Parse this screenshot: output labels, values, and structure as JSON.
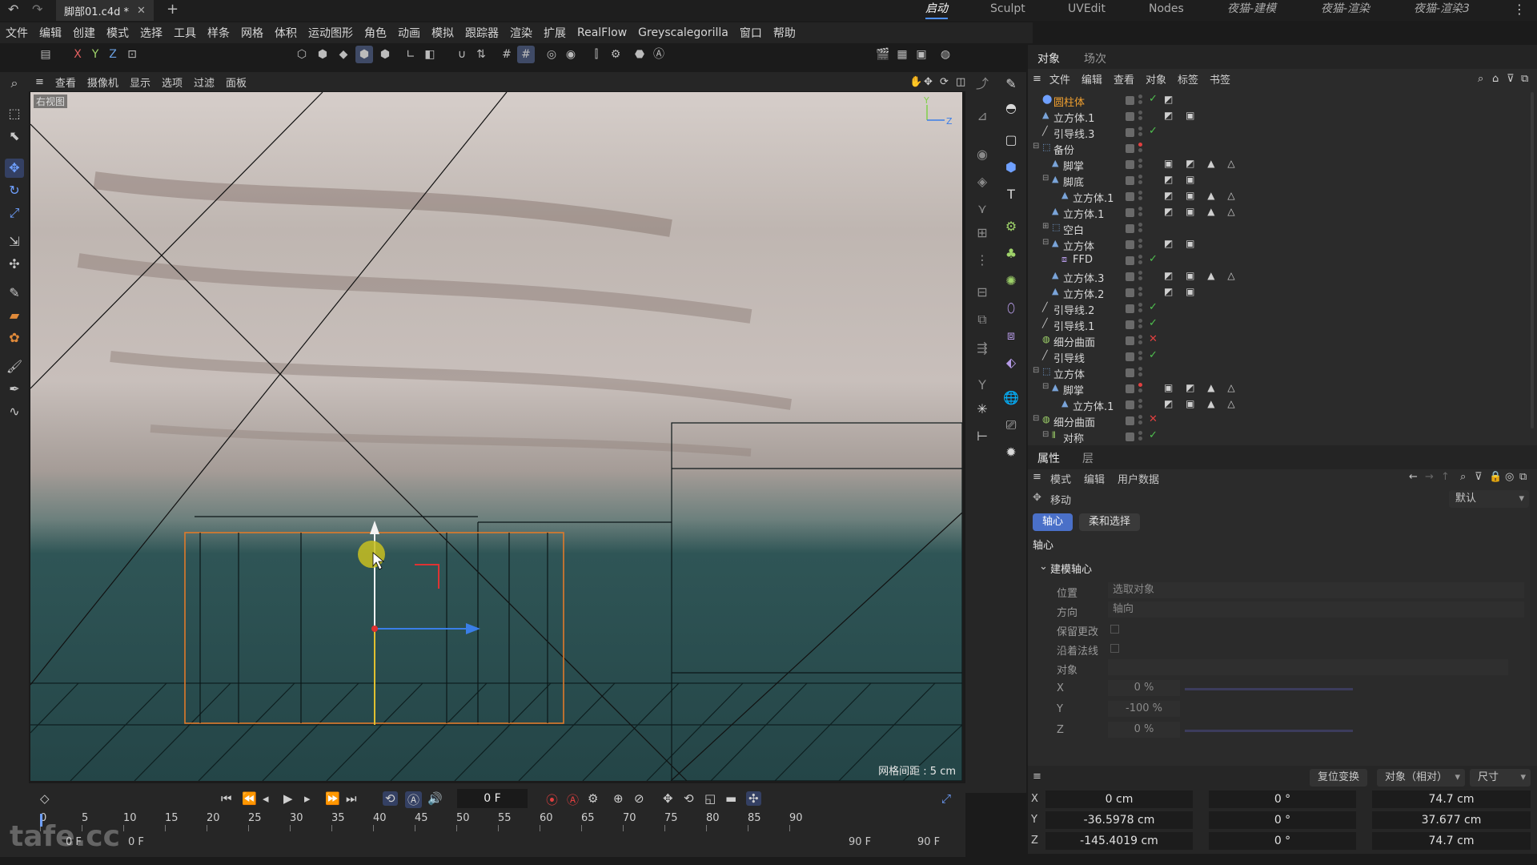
{
  "app": {
    "doc_tab": "脚部01.c4d *",
    "layouts": [
      "启动",
      "Sculpt",
      "UVEdit",
      "Nodes",
      "夜猫-建模",
      "夜猫-渲染",
      "夜猫-渲染3"
    ],
    "active_layout": "启动"
  },
  "menubar": [
    "文件",
    "编辑",
    "创建",
    "模式",
    "选择",
    "工具",
    "样条",
    "网格",
    "体积",
    "运动图形",
    "角色",
    "动画",
    "模拟",
    "跟踪器",
    "渲染",
    "扩展",
    "RealFlow",
    "Greyscalegorilla",
    "窗口",
    "帮助"
  ],
  "axis_toggles": [
    "X",
    "Y",
    "Z"
  ],
  "viewport": {
    "menu": [
      "查看",
      "摄像机",
      "显示",
      "选项",
      "过滤",
      "面板"
    ],
    "label": "右视图",
    "grid_spacing": "网格间距 : 5 cm",
    "axis_y": "Y",
    "axis_z": "Z"
  },
  "object_manager": {
    "tabs": [
      "对象",
      "场次"
    ],
    "menu": [
      "文件",
      "编辑",
      "查看",
      "对象",
      "标签",
      "书签"
    ],
    "objects": [
      {
        "name": "圆柱体",
        "depth": 0,
        "icon": "cylinder-icon",
        "status": "check",
        "selected": true,
        "tags": "◩"
      },
      {
        "name": "立方体.1",
        "depth": 0,
        "icon": "polygon-object-icon",
        "status": "",
        "tags": "◩ ▣"
      },
      {
        "name": "引导线.3",
        "depth": 0,
        "icon": "spline-icon",
        "status": "check",
        "tags": ""
      },
      {
        "name": "备份",
        "depth": 0,
        "icon": "null-icon",
        "status": "dot",
        "expand": "−",
        "tags": ""
      },
      {
        "name": "脚掌",
        "depth": 1,
        "icon": "polygon-object-icon",
        "status": "",
        "tags": "▣ ◩ ▲ △"
      },
      {
        "name": "脚底",
        "depth": 1,
        "icon": "polygon-object-icon",
        "status": "",
        "expand": "−",
        "tags": "◩ ▣"
      },
      {
        "name": "立方体.1",
        "depth": 2,
        "icon": "polygon-object-icon",
        "status": "",
        "tags": "◩ ▣ ▲ △"
      },
      {
        "name": "立方体.1",
        "depth": 1,
        "icon": "polygon-object-icon",
        "status": "",
        "tags": "◩ ▣ ▲ △"
      },
      {
        "name": "空白",
        "depth": 1,
        "icon": "null-icon",
        "status": "",
        "expand": "+",
        "tags": ""
      },
      {
        "name": "立方体",
        "depth": 1,
        "icon": "polygon-object-icon",
        "status": "",
        "expand": "−",
        "tags": "◩ ▣"
      },
      {
        "name": "FFD",
        "depth": 2,
        "icon": "ffd-icon",
        "status": "check",
        "tags": ""
      },
      {
        "name": "立方体.3",
        "depth": 1,
        "icon": "polygon-object-icon",
        "status": "",
        "tags": "◩ ▣ ▲ △"
      },
      {
        "name": "立方体.2",
        "depth": 1,
        "icon": "polygon-object-icon",
        "status": "",
        "tags": "◩ ▣"
      },
      {
        "name": "引导线.2",
        "depth": 0,
        "icon": "spline-icon",
        "status": "check",
        "tags": ""
      },
      {
        "name": "引导线.1",
        "depth": 0,
        "icon": "spline-icon",
        "status": "check",
        "tags": ""
      },
      {
        "name": "细分曲面",
        "depth": 0,
        "icon": "subdivision-icon",
        "status": "cross",
        "tags": ""
      },
      {
        "name": "引导线",
        "depth": 0,
        "icon": "spline-icon",
        "status": "check",
        "tags": ""
      },
      {
        "name": "立方体",
        "depth": 0,
        "icon": "null-icon",
        "status": "",
        "expand": "−",
        "tags": ""
      },
      {
        "name": "脚掌",
        "depth": 1,
        "icon": "polygon-object-icon",
        "status": "dot",
        "expand": "−",
        "tags": "▣ ◩ ▲ △"
      },
      {
        "name": "立方体.1",
        "depth": 2,
        "icon": "polygon-object-icon",
        "status": "",
        "tags": "◩ ▣ ▲ △"
      },
      {
        "name": "细分曲面",
        "depth": 0,
        "icon": "subdivision-icon",
        "status": "cross",
        "expand": "−",
        "tags": ""
      },
      {
        "name": "对称",
        "depth": 1,
        "icon": "symmetry-icon",
        "status": "check",
        "expand": "−",
        "tags": ""
      }
    ]
  },
  "attributes": {
    "tabs": [
      "属性",
      "层"
    ],
    "menu": [
      "模式",
      "编辑",
      "用户数据"
    ],
    "tool_title": "移动",
    "preset": "默认",
    "subtabs": [
      "轴心",
      "柔和选择"
    ],
    "section": "轴心",
    "group": "建模轴心",
    "fields": [
      {
        "label": "位置",
        "value": "选取对象"
      },
      {
        "label": "方向",
        "value": "轴向"
      },
      {
        "label": "保留更改",
        "value": ""
      },
      {
        "label": "沿着法线",
        "value": ""
      },
      {
        "label": "对象",
        "value": ""
      }
    ],
    "xyz": [
      {
        "label": "X",
        "value": "0 %"
      },
      {
        "label": "Y",
        "value": "-100 %"
      },
      {
        "label": "Z",
        "value": "0 %"
      }
    ]
  },
  "coordinates": {
    "reset_label": "复位变换",
    "mode": "对象（相对）",
    "size_mode": "尺寸",
    "rows": [
      {
        "axis": "X",
        "pos": "0 cm",
        "rot": "0 °",
        "size": "74.7 cm"
      },
      {
        "axis": "Y",
        "pos": "-36.5978 cm",
        "rot": "0 °",
        "size": "37.677 cm"
      },
      {
        "axis": "Z",
        "pos": "-145.4019 cm",
        "rot": "0 °",
        "size": "74.7 cm"
      }
    ]
  },
  "timeline": {
    "current_frame": "0 F",
    "ticks": [
      "0",
      "5",
      "10",
      "15",
      "20",
      "25",
      "30",
      "35",
      "40",
      "45",
      "50",
      "55",
      "60",
      "65",
      "70",
      "75",
      "80",
      "85",
      "90"
    ],
    "start_frame": "0 F",
    "start_frame2": "0 F",
    "end_frame": "90 F",
    "end_frame2": "90 F"
  },
  "watermark": "tafe.cc"
}
